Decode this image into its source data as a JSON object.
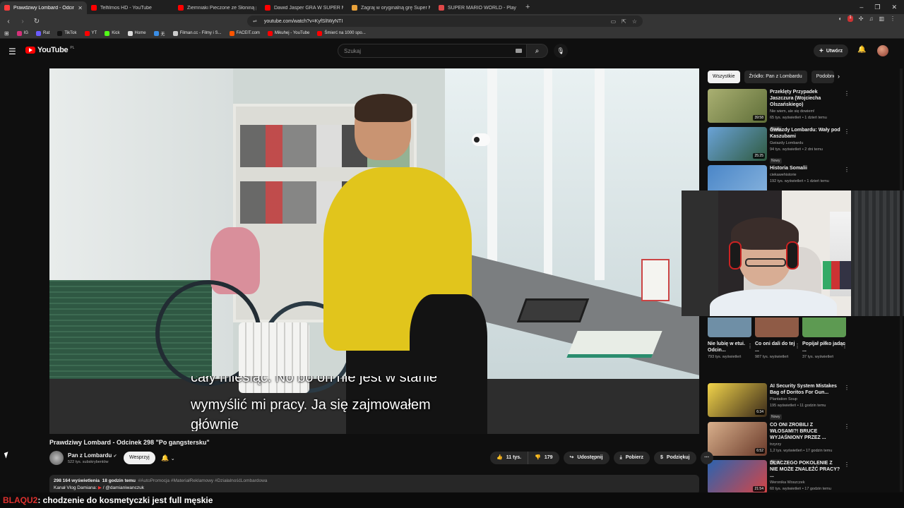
{
  "browser": {
    "tabs": [
      {
        "title": "Prawdziwy Lombard - Odcinek",
        "active": true,
        "favicon_color": "#ff3b3b"
      },
      {
        "title": "Telfilmos HD - YouTube",
        "active": false,
        "favicon_color": "#ff0000"
      },
      {
        "title": "Ziemniaki Pieczone ze Słoniną po Bi...",
        "active": false,
        "favicon_color": "#ff0000"
      },
      {
        "title": "Dawid Jasper GRA W SUPER MARIO...",
        "active": false,
        "favicon_color": "#ff0000"
      },
      {
        "title": "Zagraj w oryginalną grę Super Mario...",
        "active": false,
        "favicon_color": "#e8a13a"
      },
      {
        "title": "SUPER MARIO WORLD - Play the ro...",
        "active": false,
        "favicon_color": "#e04848"
      }
    ],
    "new_tab": "+",
    "window_controls": [
      "–",
      "❐",
      "✕"
    ],
    "url": "youtube.com/watch?v=KyfSlIWyNTI",
    "bookmarks": [
      {
        "label": "IG",
        "color": "#d6317a"
      },
      {
        "label": "Rat",
        "color": "#6b5cff"
      },
      {
        "label": "TikTok",
        "color": "#111111"
      },
      {
        "label": "YT",
        "color": "#ff0000"
      },
      {
        "label": "Kick",
        "color": "#53fc18"
      },
      {
        "label": "Home",
        "color": "#dddddd"
      },
      {
        "label": "无",
        "color": "#3a8ee6"
      },
      {
        "label": "Filman.cc - Filmy i S...",
        "color": "#cccccc"
      },
      {
        "label": "FACEIT.com",
        "color": "#ff5500"
      },
      {
        "label": "Mikuhej - YouTube",
        "color": "#ff0000"
      },
      {
        "label": "Śmierć na 1000 spo...",
        "color": "#ff0000"
      }
    ],
    "extension_badge": "1"
  },
  "header": {
    "logo": "YouTube",
    "country_code": "PL",
    "search_placeholder": "Szukaj",
    "create_label": "Utwórz"
  },
  "video": {
    "subtitle_line1": "cały miesiąc. No bo on nie jest w stanie",
    "subtitle_line2": "wymyślić mi pracy. Ja się zajmowałem",
    "subtitle_line3": "głównie",
    "title": "Prawdziwy Lombard - Odcinek 298 \"Po gangstersku\"",
    "channel": "Pan z Lombardu",
    "verified": "✔",
    "subscribers": "522 tys. subskrybentów",
    "support_label": "Wesprzyj",
    "likes": "11 tys.",
    "dislikes": "179",
    "share_label": "Udostępnij",
    "download_label": "Pobierz",
    "thanks_label": "Podziękuj",
    "more": "⋯",
    "description": {
      "views": "298 164 wyświetlenia",
      "date": "18 godzin temu",
      "tags": "#AutoPromocja #MateriałReklamowy #DziałalnośćLombardowa",
      "line2": "Kanał Vlog Damiana: ",
      "line2_link": "/ @damianiwanczuk"
    }
  },
  "sidebar": {
    "chips": [
      "Wszystkie",
      "Źródło: Pan z Lombardu",
      "Podobne"
    ],
    "recommendations": [
      {
        "title": "Przeklęty Przypadek Jaszczura (Wojciecha Olszańskiego)",
        "channel": "Nie wiem, ale się dowiem!",
        "meta": "65 tys. wyświetleń • 1 dzień temu",
        "badge": "Nowy",
        "duration": "39:58",
        "thumb_color": "#6f7f4a"
      },
      {
        "title": "Gwiazdy Lombardu: Wały pod Kaszubami",
        "channel": "Gwiazdy Lombardu",
        "meta": "94 tys. wyświetleń • 2 dni temu",
        "badge": "Nowy",
        "duration": "25:25",
        "thumb_color": "#3e6b9e"
      },
      {
        "title": "Historia Somalii",
        "channel": "ciekawehistorie",
        "meta": "192 tys. wyświetleń • 1 dzień temu",
        "badge": "",
        "duration": "",
        "thumb_color": "#4a86c8"
      },
      {
        "title": "AI Security System Mistakes Bag of Doritos For Gun...",
        "channel": "Plantation Soup",
        "meta": "195 wyświetleń • 11 godzin temu",
        "badge": "Nowy",
        "duration": "6:34",
        "thumb_color": "#c98a2a"
      },
      {
        "title": "CO ONI ZROBILI Z WŁOSAMI?! BRUCE WYJAŚNIONY PRZEZ ...",
        "channel": "trzyrzy",
        "meta": "1,2 tys. wyświetleń • 17 godzin temu",
        "badge": "Nowy",
        "duration": "6:52",
        "thumb_color": "#8a4e3a"
      },
      {
        "title": "DLACZEGO POKOLENIE Z NIE MOŻE ZNALEŹĆ PRACY? ...",
        "channel": "Weronika Woszczek",
        "meta": "60 tys. wyświetleń • 17 godzin temu",
        "badge": "",
        "duration": "21:54",
        "thumb_color": "#c24545"
      }
    ],
    "shorts": [
      {
        "title": "Nie lubię w etui. Odcin...",
        "views": "793 tys. wyświetleń",
        "color": "#6f8fa6"
      },
      {
        "title": "Co oni dali do tej ...",
        "views": "987 tys. wyświetleń",
        "color": "#8f5b46"
      },
      {
        "title": "Popijał piłko jadąc ...",
        "views": "37 tys. wyświetleń",
        "color": "#5d9a52"
      }
    ]
  },
  "chat": {
    "user": "BLAQU2",
    "message": ": chodzenie do kosmetyczki jest full męskie"
  }
}
